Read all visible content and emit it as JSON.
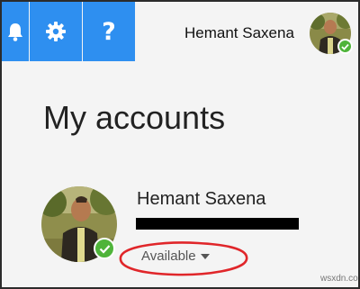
{
  "header": {
    "buttons": [
      {
        "name": "notifications",
        "icon": "bell-icon"
      },
      {
        "name": "settings",
        "icon": "gear-icon"
      },
      {
        "name": "help",
        "label": "?",
        "icon": "question-mark-icon"
      }
    ],
    "user_name": "Hemant Saxena",
    "accent_color": "#2e8ff0"
  },
  "page": {
    "title": "My accounts"
  },
  "account": {
    "name": "Hemant Saxena",
    "status": "Available",
    "presence_color": "#4fb43a"
  },
  "watermark": "wsxdn.com"
}
